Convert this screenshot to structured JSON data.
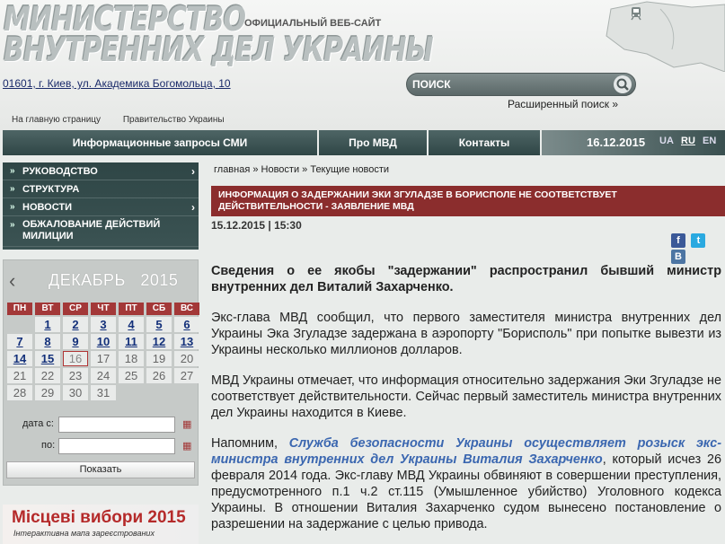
{
  "header": {
    "logo_line1": "МИНИСТЕРСТВО",
    "logo_line2": "ВНУТРЕННИХ ДЕЛ УКРАИНЫ",
    "official": "ОФИЦИАЛЬНЫЙ ВЕБ-САЙТ",
    "address": "01601, г. Киев, ул. Академика Богомольца, 10",
    "search_placeholder": "ПОИСК",
    "advanced_search": "Расширенный поиск »",
    "top_links": [
      "На главную страницу",
      "Правительство Украины"
    ]
  },
  "nav": {
    "media": "Информационные запросы СМИ",
    "about": "Про МВД",
    "contacts": "Контакты",
    "date": "16.12.2015",
    "langs": [
      "UA",
      "RU",
      "EN"
    ]
  },
  "sidebar": {
    "items": [
      {
        "label": "РУКОВОДСТВО"
      },
      {
        "label": "СТРУКТУРА"
      },
      {
        "label": "НОВОСТИ"
      },
      {
        "label": "ОБЖАЛОВАНИЕ ДЕЙСТВИЙ МИЛИЦИИ"
      }
    ]
  },
  "calendar": {
    "month": "ДЕКАБРЬ",
    "year": "2015",
    "weekdays": [
      "ПН",
      "ВТ",
      "СР",
      "ЧТ",
      "ПТ",
      "СБ",
      "ВС"
    ],
    "days": [
      "",
      "1",
      "2",
      "3",
      "4",
      "5",
      "6",
      "7",
      "8",
      "9",
      "10",
      "11",
      "12",
      "13",
      "14",
      "15",
      "16",
      "17",
      "18",
      "19",
      "20",
      "21",
      "22",
      "23",
      "24",
      "25",
      "26",
      "27",
      "28",
      "29",
      "30",
      "31",
      "",
      "",
      ""
    ],
    "linked_days": [
      "1",
      "2",
      "3",
      "4",
      "5",
      "6",
      "7",
      "8",
      "9",
      "10",
      "11",
      "12",
      "13",
      "14",
      "15"
    ],
    "today": "16",
    "from_label": "дата с:",
    "to_label": "по:",
    "show_button": "Показать"
  },
  "banner": {
    "title": "Місцеві вибори 2015",
    "subtitle": "Інтерактивна мапа зареєстрованих"
  },
  "main": {
    "breadcrumb": "главная » Новости » Текущие новости",
    "headline": "ИНФОРМАЦИЯ О ЗАДЕРЖАНИИ ЭКИ ЗГУЛАДЗЕ В БОРИСПОЛЕ НЕ СООТВЕТСТВУЕТ ДЕЙСТВИТЕЛЬНОСТИ - ЗАЯВЛЕНИЕ МВД",
    "date": "15.12.2015 | 15:30",
    "lead": "Сведения о ее якобы \"задержании\" распространил бывший министр внутренних дел Виталий Захарченко.",
    "p1": "Экс-глава МВД сообщил, что первого заместителя министра внутренних дел Украины Эка Згуладзе задержана в аэропорту \"Борисполь\" при попытке вывезти из Украины несколько миллионов долларов.",
    "p2": "МВД Украины отмечает, что информация относительно задержания Эки Згуладзе не соответствует действительности. Сейчас первый заместитель министра внутренних дел Украины находится в Киеве.",
    "p3_start": "Напомним, ",
    "p3_link": "Служба безопасности Украины осуществляет розыск экс-министра внутренних дел Украины Виталия Захарченко",
    "p3_end": ", который исчез 26 февраля 2014 года. Экс-главу МВД Украины обвиняют в совершении преступления, предусмотренного п.1 ч.2 ст.115 (Умышленное убийство) Уголовного кодекса Украины. В отношении Виталия Захарченко судом вынесено постановление о разрешении на задержание с целью привода."
  },
  "colors": {
    "nav_bg": "#2f4646",
    "headline_bg": "#8b2d2d",
    "link": "#3b67b0",
    "calendar_header": "#a33838"
  }
}
